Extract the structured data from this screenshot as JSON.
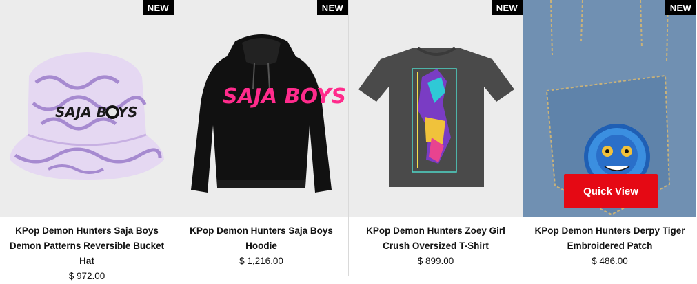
{
  "products": [
    {
      "badge": "NEW",
      "title": "KPop Demon Hunters Saja Boys Demon Patterns Reversible Bucket Hat",
      "price": "$ 972.00",
      "print_text": "SAJA BOYS"
    },
    {
      "badge": "NEW",
      "title": "KPop Demon Hunters Saja Boys Hoodie",
      "price": "$ 1,216.00",
      "print_text": "SAJA BOYS"
    },
    {
      "badge": "NEW",
      "title": "KPop Demon Hunters Zoey Girl Crush Oversized T-Shirt",
      "price": "$ 899.00"
    },
    {
      "badge": "NEW",
      "title": "KPop Demon Hunters Derpy Tiger Embroidered Patch",
      "price": "$ 486.00",
      "quick_view_label": "Quick View"
    }
  ],
  "colors": {
    "badge_bg": "#000000",
    "quick_view_bg": "#e50914",
    "hoodie_print": "#ff2b8c"
  }
}
